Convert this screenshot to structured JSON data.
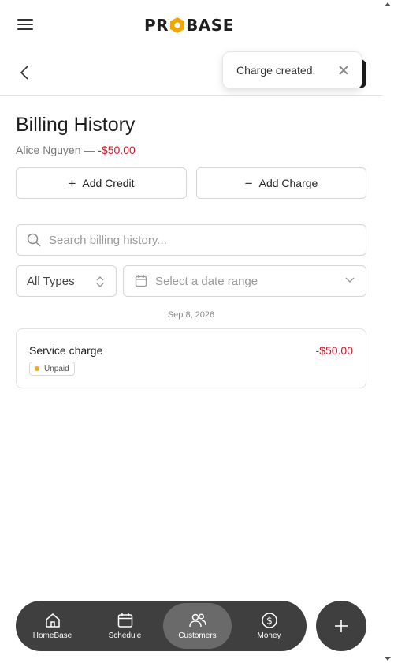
{
  "header": {
    "logo_prefix": "PR",
    "logo_suffix": "BASE"
  },
  "toast": {
    "message": "Charge created."
  },
  "page": {
    "title": "Billing History",
    "customer_name": "Alice Nguyen",
    "separator": "—",
    "balance": "-$50.00"
  },
  "actions": {
    "add_credit_label": "Add Credit",
    "add_charge_label": "Add Charge"
  },
  "filters": {
    "search_placeholder": "Search billing history...",
    "type_value": "All Types",
    "date_placeholder": "Select a date range"
  },
  "entries": [
    {
      "date": "Sep 8, 2026",
      "title": "Service charge",
      "amount": "-$50.00",
      "status": "Unpaid"
    }
  ],
  "nav": {
    "items": [
      {
        "label": "HomeBase",
        "icon": "home-icon"
      },
      {
        "label": "Schedule",
        "icon": "calendar-icon"
      },
      {
        "label": "Customers",
        "icon": "users-icon",
        "active": true
      },
      {
        "label": "Money",
        "icon": "dollar-icon"
      }
    ]
  },
  "colors": {
    "negative": "#d0182a",
    "nav_bg": "#3f3f3f",
    "nav_active": "#6a6a6a",
    "unpaid_dot": "#f5a623"
  }
}
